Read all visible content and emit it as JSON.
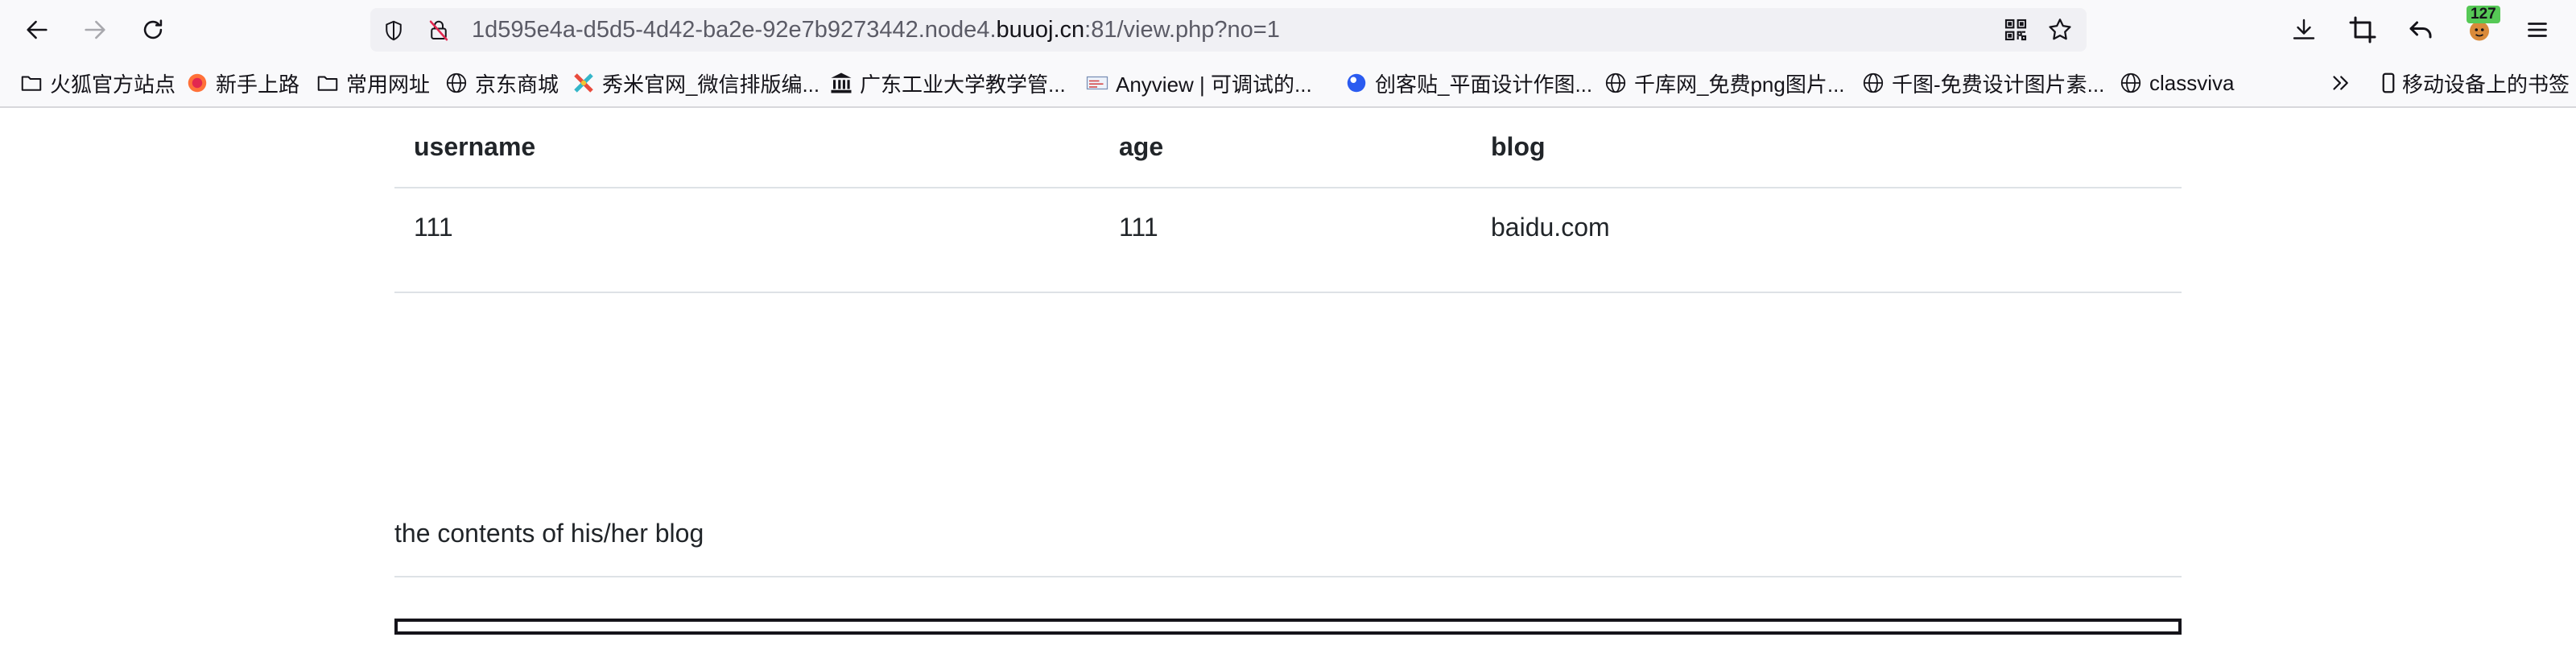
{
  "toolbar": {
    "back_icon": "arrow-left-icon",
    "forward_icon": "arrow-right-icon",
    "reload_icon": "reload-icon",
    "url_prefix": "1d595e4a-d5d5-4d42-ba2e-92e7b9273442.node4.",
    "url_host": "buuoj.cn",
    "url_suffix": ":81/view.php?no=1",
    "extension_badge": "127"
  },
  "bookmarks": [
    {
      "label": "火狐官方站点",
      "icon": "folder-icon"
    },
    {
      "label": "新手上路",
      "icon": "firefox-icon"
    },
    {
      "label": "常用网址",
      "icon": "folder-icon"
    },
    {
      "label": "京东商城",
      "icon": "globe-icon"
    },
    {
      "label": "秀米官网_微信排版编...",
      "icon": "xiumi-icon"
    },
    {
      "label": "广东工业大学教学管...",
      "icon": "building-icon"
    },
    {
      "label": "Anyview | 可调试的...",
      "icon": "anyview-icon"
    },
    {
      "label": "创客贴_平面设计作图...",
      "icon": "chuangketie-icon"
    },
    {
      "label": "千库网_免费png图片...",
      "icon": "globe-icon"
    },
    {
      "label": "千图-免费设计图片素...",
      "icon": "globe-icon"
    },
    {
      "label": "classviva",
      "icon": "globe-icon"
    },
    {
      "label": "移动设备上的书签",
      "icon": "mobile-icon"
    }
  ],
  "table": {
    "headers": [
      "username",
      "age",
      "blog"
    ],
    "rows": [
      [
        "111",
        "111",
        "baidu.com"
      ]
    ]
  },
  "blog_section": {
    "heading": "the contents of his/her blog"
  },
  "colors": {
    "toolbar_bg": "#f9f9fb",
    "urlbar_bg": "#f0f0f4",
    "badge_bg": "#56c956",
    "rule": "#dee2e6"
  }
}
